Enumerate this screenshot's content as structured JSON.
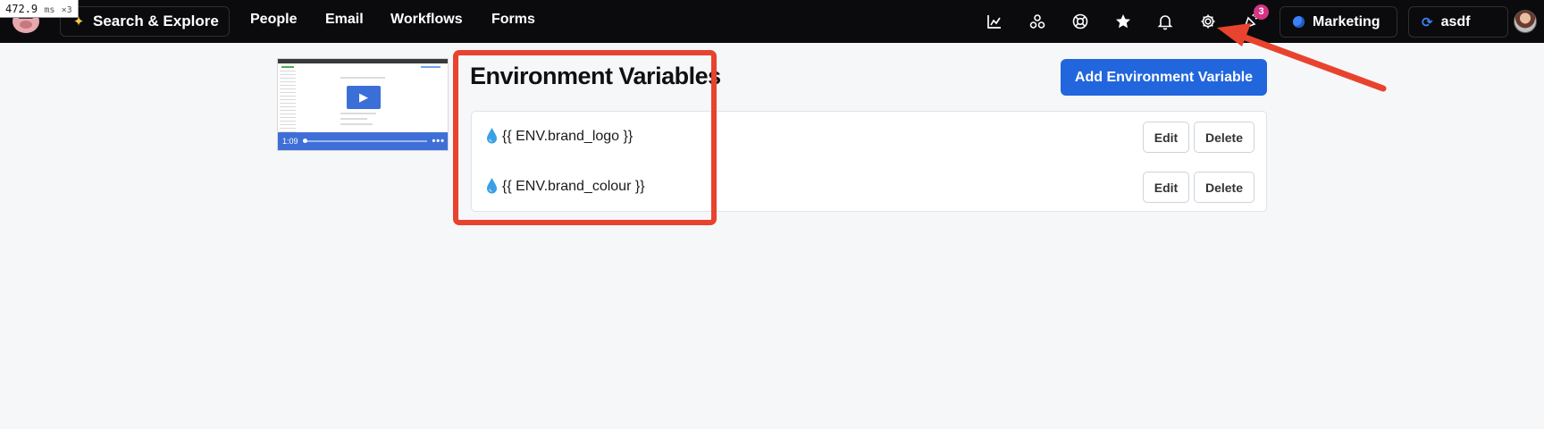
{
  "perf": {
    "ms": "472.9",
    "unit": "ms",
    "mult": "×3"
  },
  "nav": {
    "search_label": "Search & Explore",
    "links": [
      "People",
      "Email",
      "Workflows",
      "Forms"
    ],
    "icons": [
      "analytics-icon",
      "integrations-icon",
      "help-icon",
      "star-icon",
      "bell-icon",
      "gear-icon",
      "celebrate-icon"
    ],
    "notification_count": "3",
    "workspace": "Marketing",
    "project": "asdf"
  },
  "video": {
    "duration": "1:09"
  },
  "main": {
    "title": "Environment Variables",
    "add_button": "Add Environment Variable",
    "variables": [
      {
        "name": "{{ ENV.brand_logo }}"
      },
      {
        "name": "{{ ENV.brand_colour }}"
      }
    ],
    "edit_label": "Edit",
    "delete_label": "Delete"
  },
  "colors": {
    "accent": "#2266dd",
    "annotation": "#e8432e",
    "nav_bg": "#0b0b0d"
  }
}
